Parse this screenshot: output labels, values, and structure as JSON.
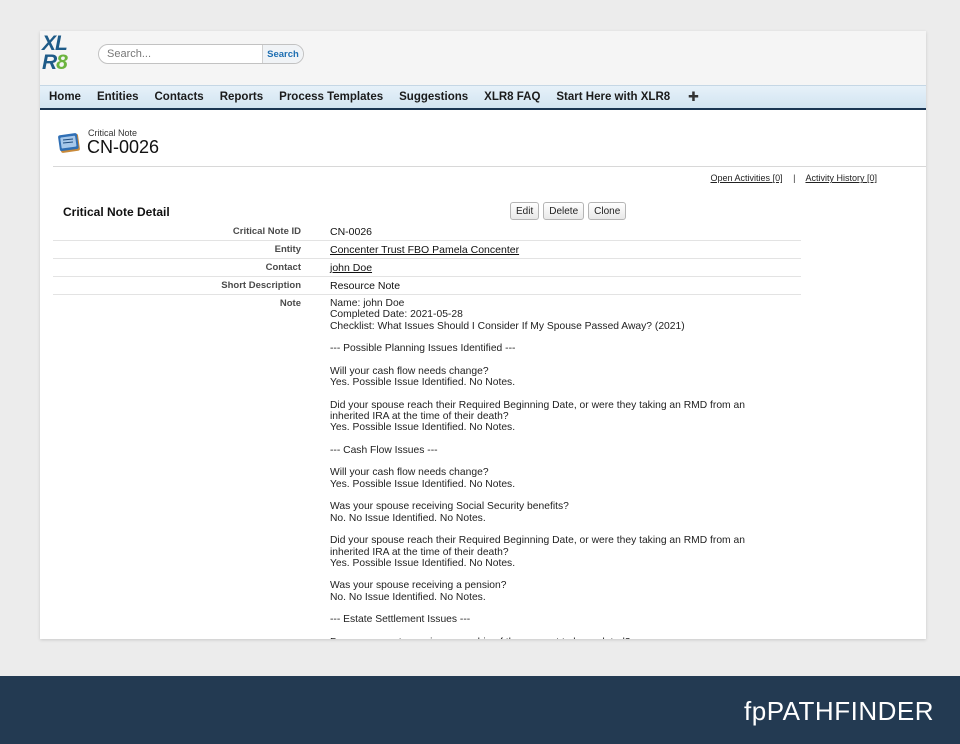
{
  "logo": {
    "line1": "XL",
    "line2_a": "R",
    "line2_b": "8"
  },
  "search": {
    "placeholder": "Search...",
    "button_label": "Search"
  },
  "nav": {
    "items": [
      "Home",
      "Entities",
      "Contacts",
      "Reports",
      "Process Templates",
      "Suggestions",
      "XLR8 FAQ",
      "Start Here with XLR8"
    ],
    "add_tab_glyph": "✚"
  },
  "record": {
    "type_label": "Critical Note",
    "name": "CN-0026"
  },
  "related": {
    "open_activities": "Open Activities",
    "open_activities_count": "[0]",
    "separator": "|",
    "activity_history": "Activity History",
    "activity_history_count": "[0]"
  },
  "detail": {
    "section_title": "Critical Note Detail",
    "buttons": {
      "edit": "Edit",
      "delete": "Delete",
      "clone": "Clone"
    },
    "fields": {
      "id_label": "Critical Note ID",
      "id_value": "CN-0026",
      "entity_label": "Entity",
      "entity_value": "Concenter Trust FBO Pamela Concenter",
      "contact_label": "Contact",
      "contact_value": "john Doe",
      "short_desc_label": "Short Description",
      "short_desc_value": "Resource Note",
      "note_label": "Note",
      "note_value": "Name: john Doe\nCompleted Date: 2021-05-28\nChecklist: What Issues Should I Consider If My Spouse Passed Away? (2021)\n\n--- Possible Planning Issues Identified ---\n\nWill your cash flow needs change?\nYes. Possible Issue Identified. No Notes.\n\nDid your spouse reach their Required Beginning Date, or were they taking an RMD from an inherited IRA at the time of their death?\nYes. Possible Issue Identified. No Notes.\n\n--- Cash Flow Issues ---\n\nWill your cash flow needs change?\nYes. Possible Issue Identified. No Notes.\n\nWas your spouse receiving Social Security benefits?\nNo. No Issue Identified. No Notes.\n\nDid your spouse reach their Required Beginning Date, or were they taking an RMD from an inherited IRA at the time of their death?\nYes. Possible Issue Identified. No Notes.\n\nWas your spouse receiving a pension?\nNo. No Issue Identified. No Notes.\n\n--- Estate Settlement Issues ---\n\nDo any accounts require ownership of the account to be updated?"
    }
  },
  "footer": {
    "brand": "fpPATHFINDER"
  },
  "colors": {
    "nav_border": "#1a3552",
    "footer_bg": "#233a52",
    "logo_blue": "#1e5b88",
    "logo_green": "#6cb43f",
    "search_button_text": "#1f6fb2"
  },
  "icons": {
    "record_icon": "note-record-icon"
  }
}
